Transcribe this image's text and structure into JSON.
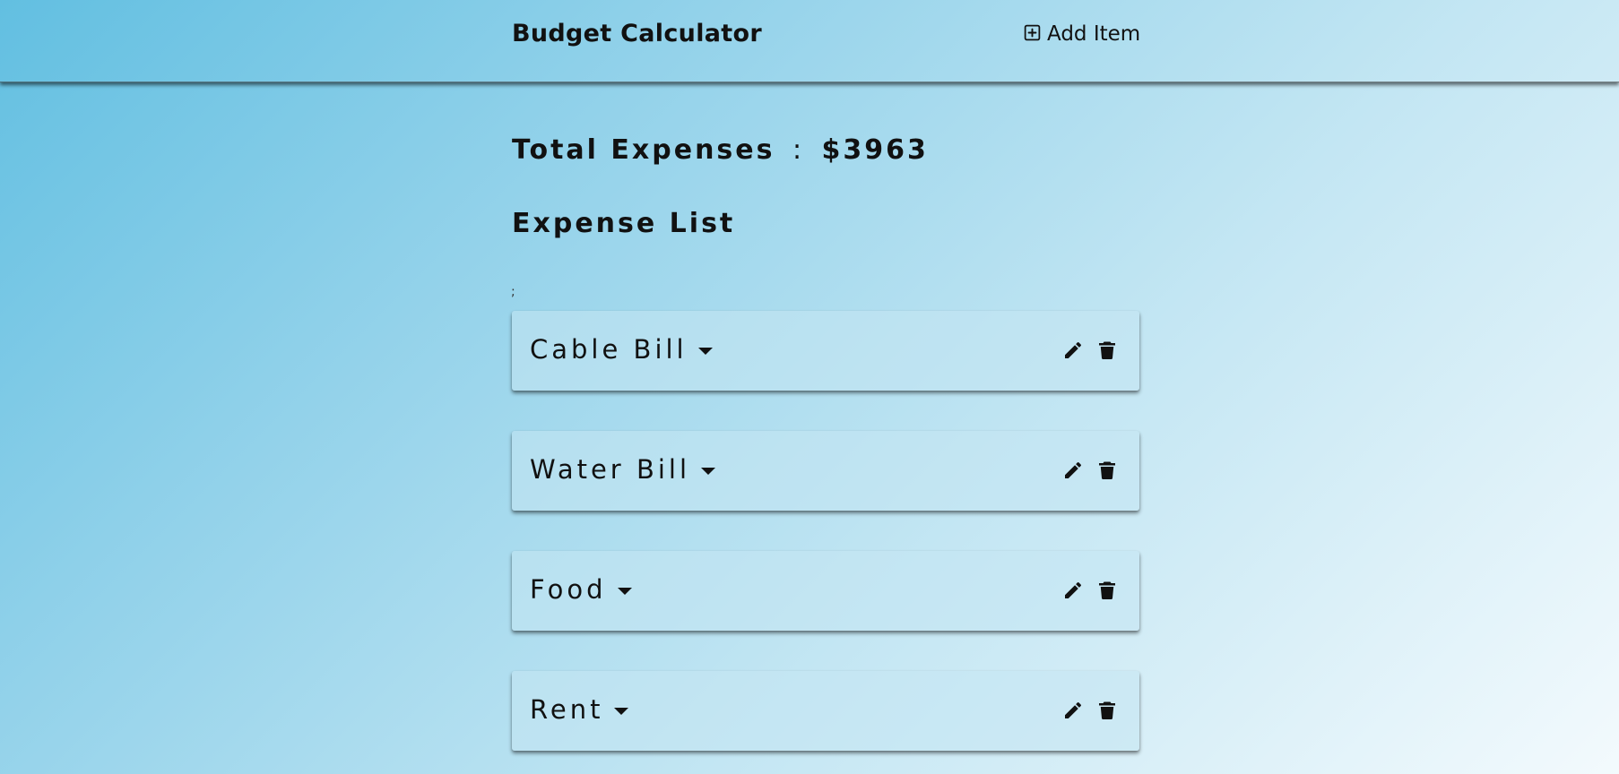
{
  "header": {
    "title": "Budget Calculator",
    "add_item_label": "Add Item",
    "add_item_icon": "plus-square-icon"
  },
  "summary": {
    "total_label": "Total Expenses",
    "separator": ":",
    "total_value": "$3963"
  },
  "expense_list": {
    "title": "Expense List",
    "stray_text": ";",
    "items": [
      {
        "name": "Cable Bill",
        "expand_icon": "caret-down-icon",
        "edit_icon": "pencil-icon",
        "delete_icon": "trash-icon"
      },
      {
        "name": "Water Bill",
        "expand_icon": "caret-down-icon",
        "edit_icon": "pencil-icon",
        "delete_icon": "trash-icon"
      },
      {
        "name": "Food",
        "expand_icon": "caret-down-icon",
        "edit_icon": "pencil-icon",
        "delete_icon": "trash-icon"
      },
      {
        "name": "Rent",
        "expand_icon": "caret-down-icon",
        "edit_icon": "pencil-icon",
        "delete_icon": "trash-icon"
      }
    ]
  },
  "colors": {
    "background_start": "#62bfe1",
    "background_end": "#f3fafd",
    "text": "#111111"
  }
}
